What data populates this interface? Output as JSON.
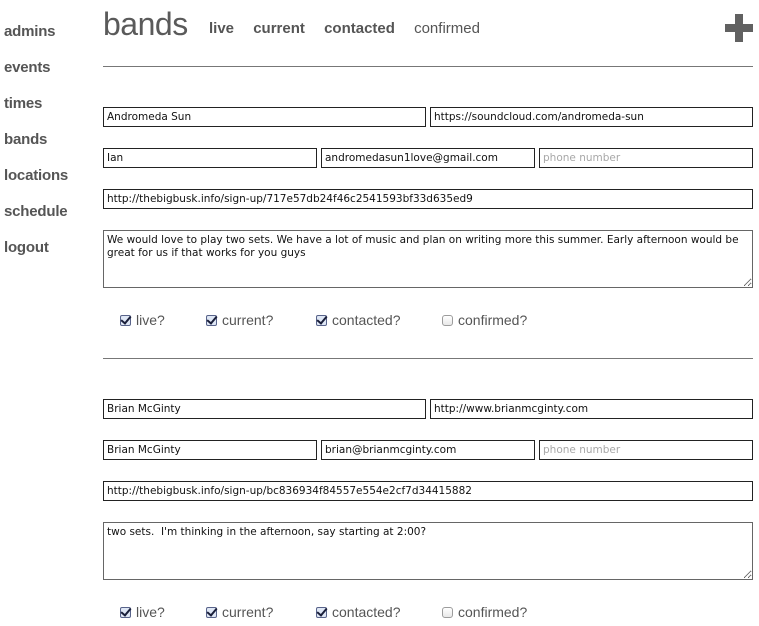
{
  "sidebar": {
    "items": [
      {
        "label": "admins"
      },
      {
        "label": "events"
      },
      {
        "label": "times"
      },
      {
        "label": "bands"
      },
      {
        "label": "locations"
      },
      {
        "label": "schedule"
      },
      {
        "label": "logout"
      }
    ]
  },
  "header": {
    "title": "bands",
    "filters": [
      {
        "label": "live",
        "active": true
      },
      {
        "label": "current",
        "active": true
      },
      {
        "label": "contacted",
        "active": true
      },
      {
        "label": "confirmed",
        "active": false
      }
    ],
    "add_icon": "plus-icon"
  },
  "bands": [
    {
      "name": "Andromeda Sun",
      "website": "https://soundcloud.com/andromeda-sun",
      "contact_name": "Ian",
      "email": "andromedasun1love@gmail.com",
      "phone": "",
      "phone_placeholder": "phone number",
      "signup_url": "http://thebigbusk.info/sign-up/717e57db24f46c2541593bf33d635ed9",
      "notes": "We would love to play two sets. We have a lot of music and plan on writing more this summer. Early afternoon would be great for us if that works for you guys",
      "checks": [
        {
          "label": "live?",
          "checked": true
        },
        {
          "label": "current?",
          "checked": true
        },
        {
          "label": "contacted?",
          "checked": true
        },
        {
          "label": "confirmed?",
          "checked": false
        }
      ]
    },
    {
      "name": "Brian McGinty",
      "website": "http://www.brianmcginty.com",
      "contact_name": "Brian McGinty",
      "email": "brian@brianmcginty.com",
      "phone": "",
      "phone_placeholder": "phone number",
      "signup_url": "http://thebigbusk.info/sign-up/bc836934f84557e554e2cf7d34415882",
      "notes": "two sets.  I'm thinking in the afternoon, say starting at 2:00?",
      "checks": [
        {
          "label": "live?",
          "checked": true
        },
        {
          "label": "current?",
          "checked": true
        },
        {
          "label": "contacted?",
          "checked": true
        },
        {
          "label": "confirmed?",
          "checked": false
        }
      ]
    }
  ]
}
